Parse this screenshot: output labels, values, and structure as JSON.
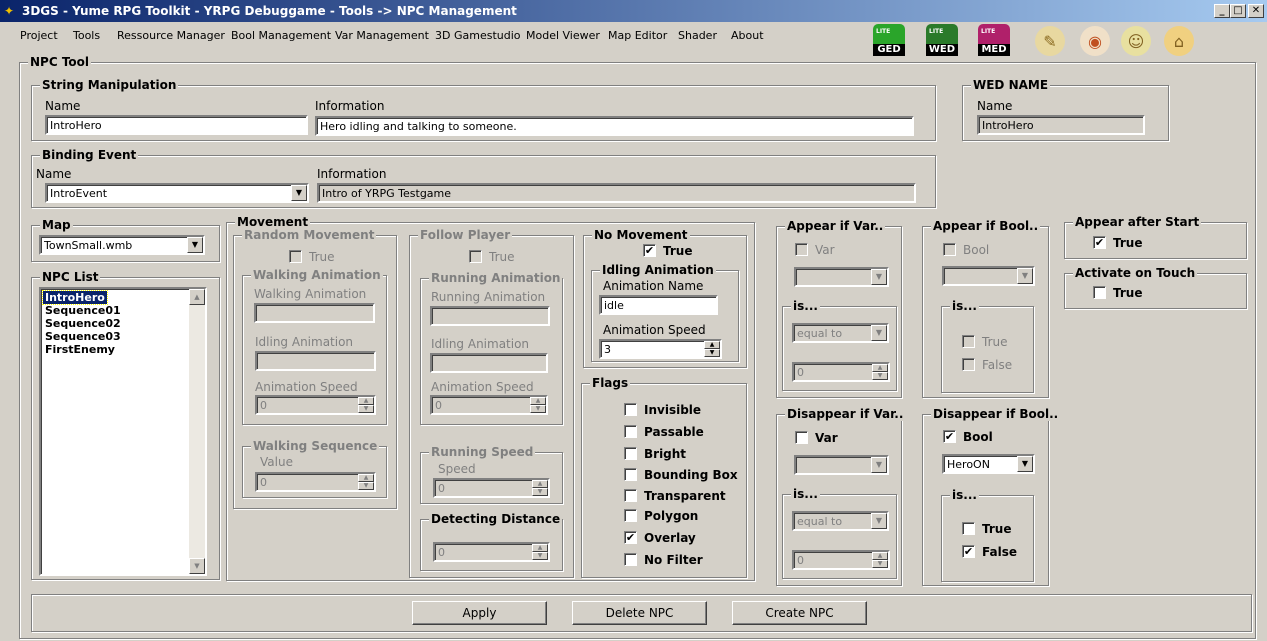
{
  "window": {
    "title": "3DGS - Yume RPG Toolkit - YRPG Debuggame - Tools -> NPC Management",
    "minimize": "_",
    "maximize": "□",
    "close": "✕"
  },
  "menu": [
    "Project",
    "Tools",
    "Ressource Manager",
    "Bool Management",
    "Var Management",
    "3D Gamestudio",
    "Model Viewer",
    "Map Editor",
    "Shader",
    "About"
  ],
  "toolbar": {
    "ged": {
      "lite": "LITE",
      "label": "GED",
      "color": "#2aa52a"
    },
    "wed": {
      "lite": "LITE",
      "label": "WED",
      "color": "#2a7a2a"
    },
    "med": {
      "lite": "LITE",
      "label": "MED",
      "color": "#b0206a"
    }
  },
  "npc_tool": {
    "title": "NPC Tool",
    "string_manipulation": {
      "title": "String Manipulation",
      "name_label": "Name",
      "name_value": "IntroHero",
      "info_label": "Information",
      "info_value": "Hero idling and talking to someone."
    },
    "wed_name": {
      "title": "WED NAME",
      "name_label": "Name",
      "name_value": "IntroHero"
    },
    "binding_event": {
      "title": "Binding Event",
      "name_label": "Name",
      "name_value": "IntroEvent",
      "info_label": "Information",
      "info_value": "Intro of YRPG Testgame"
    },
    "map": {
      "title": "Map",
      "value": "TownSmall.wmb"
    },
    "npc_list": {
      "title": "NPC List",
      "items": [
        "IntroHero",
        "Sequence01",
        "Sequence02",
        "Sequence03",
        "FirstEnemy"
      ],
      "selected": "IntroHero"
    },
    "movement": {
      "title": "Movement",
      "random_movement": {
        "title": "Random Movement",
        "true_label": "True",
        "walking_animation": {
          "title": "Walking Animation",
          "walking_label": "Walking Animation",
          "idling_label": "Idling Animation",
          "speed_label": "Animation Speed",
          "speed_value": "0"
        },
        "walking_sequence": {
          "title": "Walking Sequence",
          "value_label": "Value",
          "value": "0"
        }
      },
      "follow_player": {
        "title": "Follow Player",
        "true_label": "True",
        "running_animation": {
          "title": "Running Animation",
          "running_label": "Running Animation",
          "idling_label": "Idling Animation",
          "speed_label": "Animation Speed",
          "speed_value": "0"
        },
        "running_speed": {
          "title": "Running Speed",
          "speed_label": "Speed",
          "value": "0"
        },
        "detecting_distance": {
          "title": "Detecting Distance",
          "value": "0"
        }
      },
      "no_movement": {
        "title": "No Movement",
        "true_label": "True",
        "checked": true,
        "idling_animation": {
          "title": "Idling Animation",
          "name_label": "Animation Name",
          "name_value": "idle",
          "speed_label": "Animation Speed",
          "speed_value": "3"
        }
      },
      "flags": {
        "title": "Flags",
        "items": [
          {
            "label": "Invisible",
            "checked": false
          },
          {
            "label": "Passable",
            "checked": false
          },
          {
            "label": "Bright",
            "checked": false
          },
          {
            "label": "Bounding Box",
            "checked": false
          },
          {
            "label": "Transparent",
            "checked": false
          },
          {
            "label": "Polygon",
            "checked": false
          },
          {
            "label": "Overlay",
            "checked": true
          },
          {
            "label": "No Filter",
            "checked": false
          }
        ]
      }
    },
    "appear_var": {
      "title": "Appear if Var..",
      "var_label": "Var",
      "is_title": "is...",
      "op_value": "equal to",
      "num_value": "0"
    },
    "disappear_var": {
      "title": "Disappear if Var..",
      "var_label": "Var",
      "is_title": "is...",
      "op_value": "equal to",
      "num_value": "0"
    },
    "appear_bool": {
      "title": "Appear if Bool..",
      "bool_label": "Bool",
      "is_title": "is...",
      "true_label": "True",
      "false_label": "False"
    },
    "disappear_bool": {
      "title": "Disappear if Bool..",
      "bool_label": "Bool",
      "bool_checked": true,
      "bool_value": "HeroON",
      "is_title": "is...",
      "true_label": "True",
      "false_label": "False",
      "false_checked": true
    },
    "appear_after_start": {
      "title": "Appear after Start",
      "true_label": "True",
      "checked": true
    },
    "activate_on_touch": {
      "title": "Activate on Touch",
      "true_label": "True",
      "checked": false
    }
  },
  "buttons": {
    "apply": "Apply",
    "delete": "Delete NPC",
    "create": "Create NPC"
  },
  "check_mark": "✔"
}
